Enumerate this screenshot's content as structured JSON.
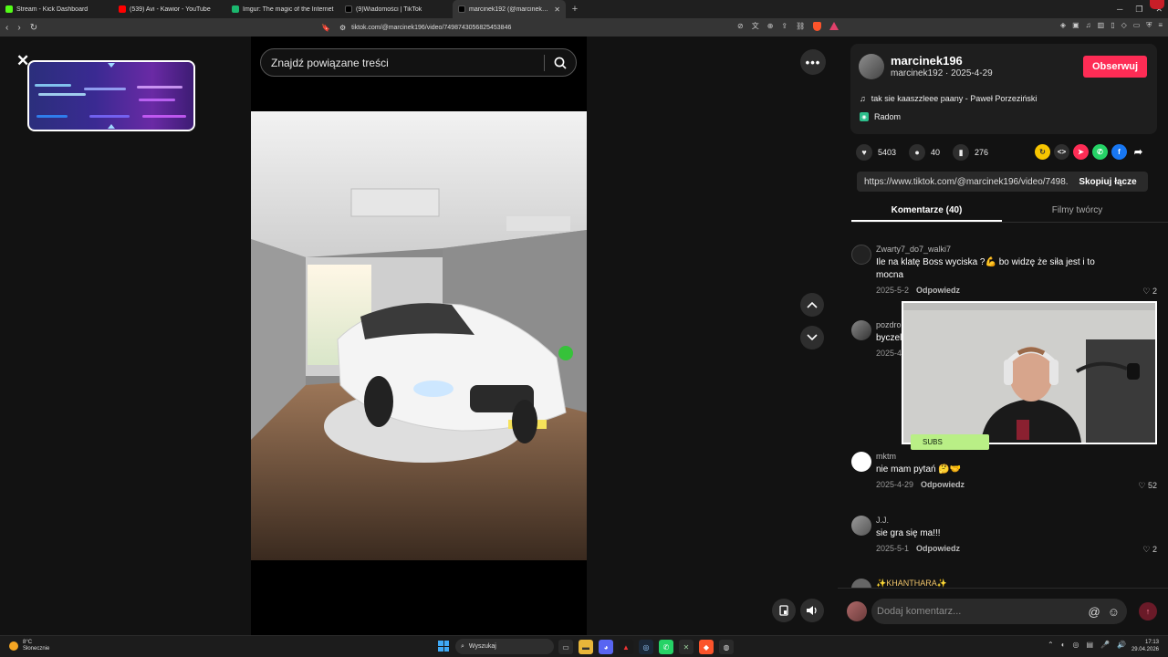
{
  "browser": {
    "tabs": [
      {
        "label": "Stream - Kick Dashboard",
        "color": "#53fc18",
        "active": false
      },
      {
        "label": "(539) Avi - Kawior - YouTube",
        "color": "#ff0000",
        "active": false
      },
      {
        "label": "Imgur: The magic of the Internet",
        "color": "#1bb76e",
        "active": false
      },
      {
        "label": "(9)Wiadomości | TikTok",
        "color": "#000000",
        "active": false
      },
      {
        "label": "marcinek192 (@marcinek19...",
        "color": "#000000",
        "active": true
      }
    ],
    "url": "tiktok.com/@marcinek196/video/7498743056825453846"
  },
  "video": {
    "search_placeholder": "Znajdź powiązane treści"
  },
  "author": {
    "username": "marcinek196",
    "nickname": "marcinek192",
    "date": "2025-4-29",
    "follow_label": "Obserwuj",
    "music": "tak sie kaaszzleee paany - Paweł Porzeziński",
    "location": "Radom"
  },
  "stats": {
    "likes": "5403",
    "comments": "40",
    "saves": "276"
  },
  "link": {
    "url": "https://www.tiktok.com/@marcinek196/video/7498...",
    "copy_label": "Skopiuj łącze"
  },
  "tabs": {
    "comments": "Komentarze (40)",
    "creator_videos": "Filmy twórcy"
  },
  "comments": [
    {
      "user": "Zwarty7_do7_walki7",
      "text": "Ile na klatę Boss wyciska ?💪 bo widzę że siła jest i to mocna",
      "date": "2025-5-2",
      "reply": "Odpowiedz",
      "likes": "2"
    },
    {
      "user": "pozdro",
      "text": "byczel",
      "date": "2025-4",
      "reply": "",
      "likes": ""
    },
    {
      "user": "mktm",
      "text": "nie mam pytań 🤔🤝",
      "date": "2025-4-29",
      "reply": "Odpowiedz",
      "likes": "52"
    },
    {
      "user": "J.J.",
      "text": "sie gra się ma!!!",
      "date": "2025-5-1",
      "reply": "Odpowiedz",
      "likes": "2"
    },
    {
      "user": "✨KHANTHARA✨",
      "text": "",
      "date": "",
      "reply": "",
      "likes": ""
    }
  ],
  "composer": {
    "placeholder": "Dodaj komentarz...",
    "at": "@"
  },
  "overlay": {
    "subs_label": "SUBS"
  },
  "taskbar": {
    "weather_temp": "8°C",
    "weather_desc": "Słonecznie",
    "search_label": "Wyszukaj",
    "time": "17:13",
    "date": "29.04.2026"
  }
}
